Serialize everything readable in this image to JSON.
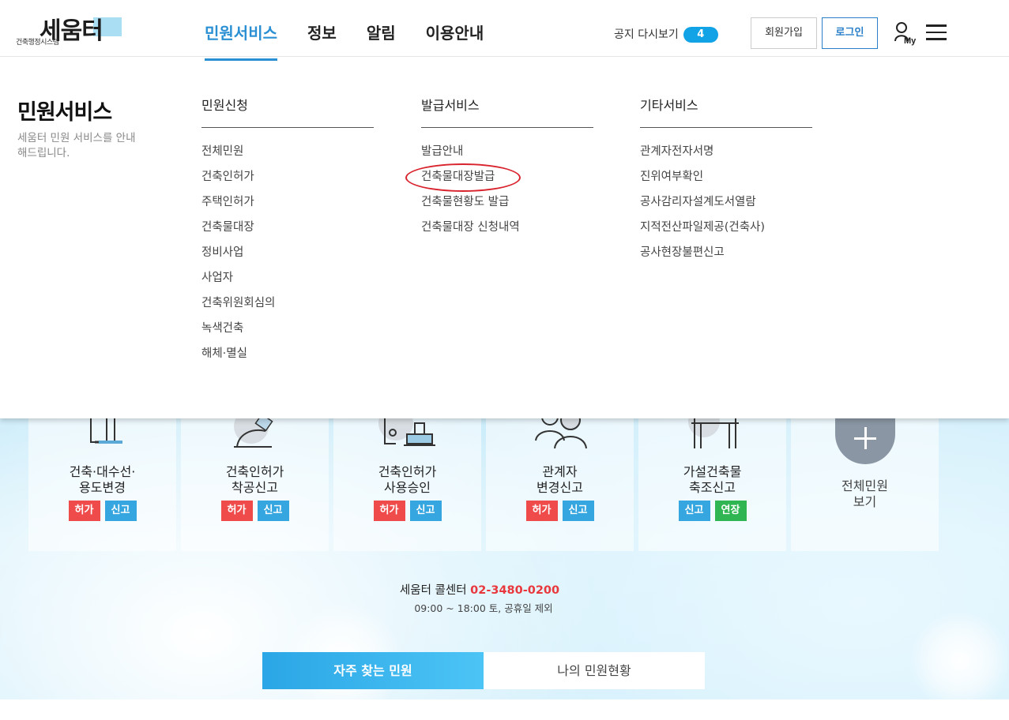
{
  "logo": {
    "main": "세움터",
    "sub": "건축행정시스템"
  },
  "gnb": [
    "민원서비스",
    "정보",
    "알림",
    "이용안내"
  ],
  "notice": {
    "label": "공지 다시보기",
    "count": "4"
  },
  "auth": {
    "join": "회원가입",
    "login": "로그인"
  },
  "my_label": "My",
  "mega": {
    "title": "민원서비스",
    "desc": "세움터 민원 서비스를 안내해드립니다.",
    "columns": [
      {
        "head": "민원신청",
        "items": [
          "전체민원",
          "건축인허가",
          "주택인허가",
          "건축물대장",
          "정비사업",
          "사업자",
          "건축위원회심의",
          "녹색건축",
          "해체·멸실"
        ]
      },
      {
        "head": "발급서비스",
        "items": [
          "발급안내",
          "건축물대장발급",
          "건축물현황도 발급",
          "건축물대장 신청내역"
        ]
      },
      {
        "head": "기타서비스",
        "items": [
          "관계자전자서명",
          "진위여부확인",
          "공사감리자설계도서열람",
          "지적전산파일제공(건축사)",
          "공사현장불편신고"
        ]
      }
    ]
  },
  "cards": [
    {
      "title1": "건축·대수선·",
      "title2": "용도변경",
      "tags": [
        {
          "label": "허가",
          "color": "red"
        },
        {
          "label": "신고",
          "color": "blue"
        }
      ],
      "icon": "document-pen-icon"
    },
    {
      "title1": "건축인허가",
      "title2": "착공신고",
      "tags": [
        {
          "label": "허가",
          "color": "red"
        },
        {
          "label": "신고",
          "color": "blue"
        }
      ],
      "icon": "hardhat-icon"
    },
    {
      "title1": "건축인허가",
      "title2": "사용승인",
      "tags": [
        {
          "label": "허가",
          "color": "red"
        },
        {
          "label": "신고",
          "color": "blue"
        }
      ],
      "icon": "stamp-icon"
    },
    {
      "title1": "관계자",
      "title2": "변경신고",
      "tags": [
        {
          "label": "허가",
          "color": "red"
        },
        {
          "label": "신고",
          "color": "blue"
        }
      ],
      "icon": "people-icon"
    },
    {
      "title1": "가설건축물",
      "title2": "축조신고",
      "tags": [
        {
          "label": "신고",
          "color": "blue"
        },
        {
          "label": "연장",
          "color": "green"
        }
      ],
      "icon": "scaffold-icon"
    }
  ],
  "all_card": {
    "title1": "전체민원",
    "title2": "보기"
  },
  "call": {
    "label": "세움터 콜센터",
    "number": "02-3480-0200",
    "hours": "09:00 ~ 18:00 토, 공휴일 제외"
  },
  "bottom_tabs": {
    "active": "자주 찾는 민원",
    "other": "나의 민원현황"
  },
  "colors": {
    "accent": "#2a8fd3",
    "badge": "#12a3e6",
    "red_tag": "#ef4b4b",
    "blue_tag": "#36a6e0",
    "green_tag": "#2fb552",
    "circle_mark": "#d9232d"
  }
}
